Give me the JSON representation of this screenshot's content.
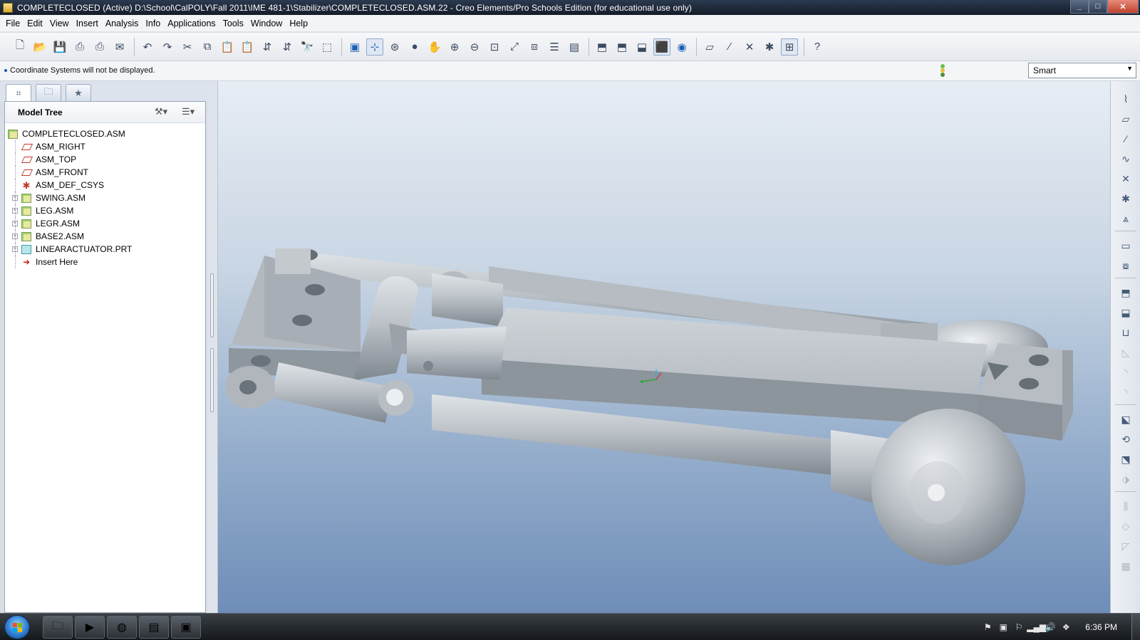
{
  "window": {
    "title": "COMPLETECLOSED (Active) D:\\School\\CalPOLY\\Fall 2011\\IME 481-1\\Stabilizer\\COMPLETECLOSED.ASM.22 - Creo Elements/Pro Schools Edition (for educational use only)",
    "minimize": "_",
    "maximize": "□",
    "close": "✕"
  },
  "menu": [
    "File",
    "Edit",
    "View",
    "Insert",
    "Analysis",
    "Info",
    "Applications",
    "Tools",
    "Window",
    "Help"
  ],
  "message": "Coordinate Systems will not be displayed.",
  "filter": {
    "value": "Smart"
  },
  "model_tree": {
    "title": "Model Tree",
    "items": [
      {
        "label": "COMPLETECLOSED.ASM",
        "type": "asm",
        "level": 0,
        "expandable": false
      },
      {
        "label": "ASM_RIGHT",
        "type": "plane",
        "level": 1,
        "expandable": false
      },
      {
        "label": "ASM_TOP",
        "type": "plane",
        "level": 1,
        "expandable": false
      },
      {
        "label": "ASM_FRONT",
        "type": "plane",
        "level": 1,
        "expandable": false
      },
      {
        "label": "ASM_DEF_CSYS",
        "type": "csys",
        "level": 1,
        "expandable": false
      },
      {
        "label": "SWING.ASM",
        "type": "asm",
        "level": 1,
        "expandable": true
      },
      {
        "label": "LEG.ASM",
        "type": "asm",
        "level": 1,
        "expandable": true
      },
      {
        "label": "LEGR.ASM",
        "type": "asm",
        "level": 1,
        "expandable": true
      },
      {
        "label": "BASE2.ASM",
        "type": "asm",
        "level": 1,
        "expandable": true
      },
      {
        "label": "LINEARACTUATOR.PRT",
        "type": "prt",
        "level": 1,
        "expandable": true
      },
      {
        "label": "Insert Here",
        "type": "insert",
        "level": 1,
        "expandable": false
      }
    ]
  },
  "taskbar": {
    "clock": "6:36 PM"
  },
  "colors": {
    "model": "#b9bec4",
    "model_shadow": "#7c848d",
    "background_top": "#e7edf4",
    "background_bottom": "#6e8db8"
  }
}
